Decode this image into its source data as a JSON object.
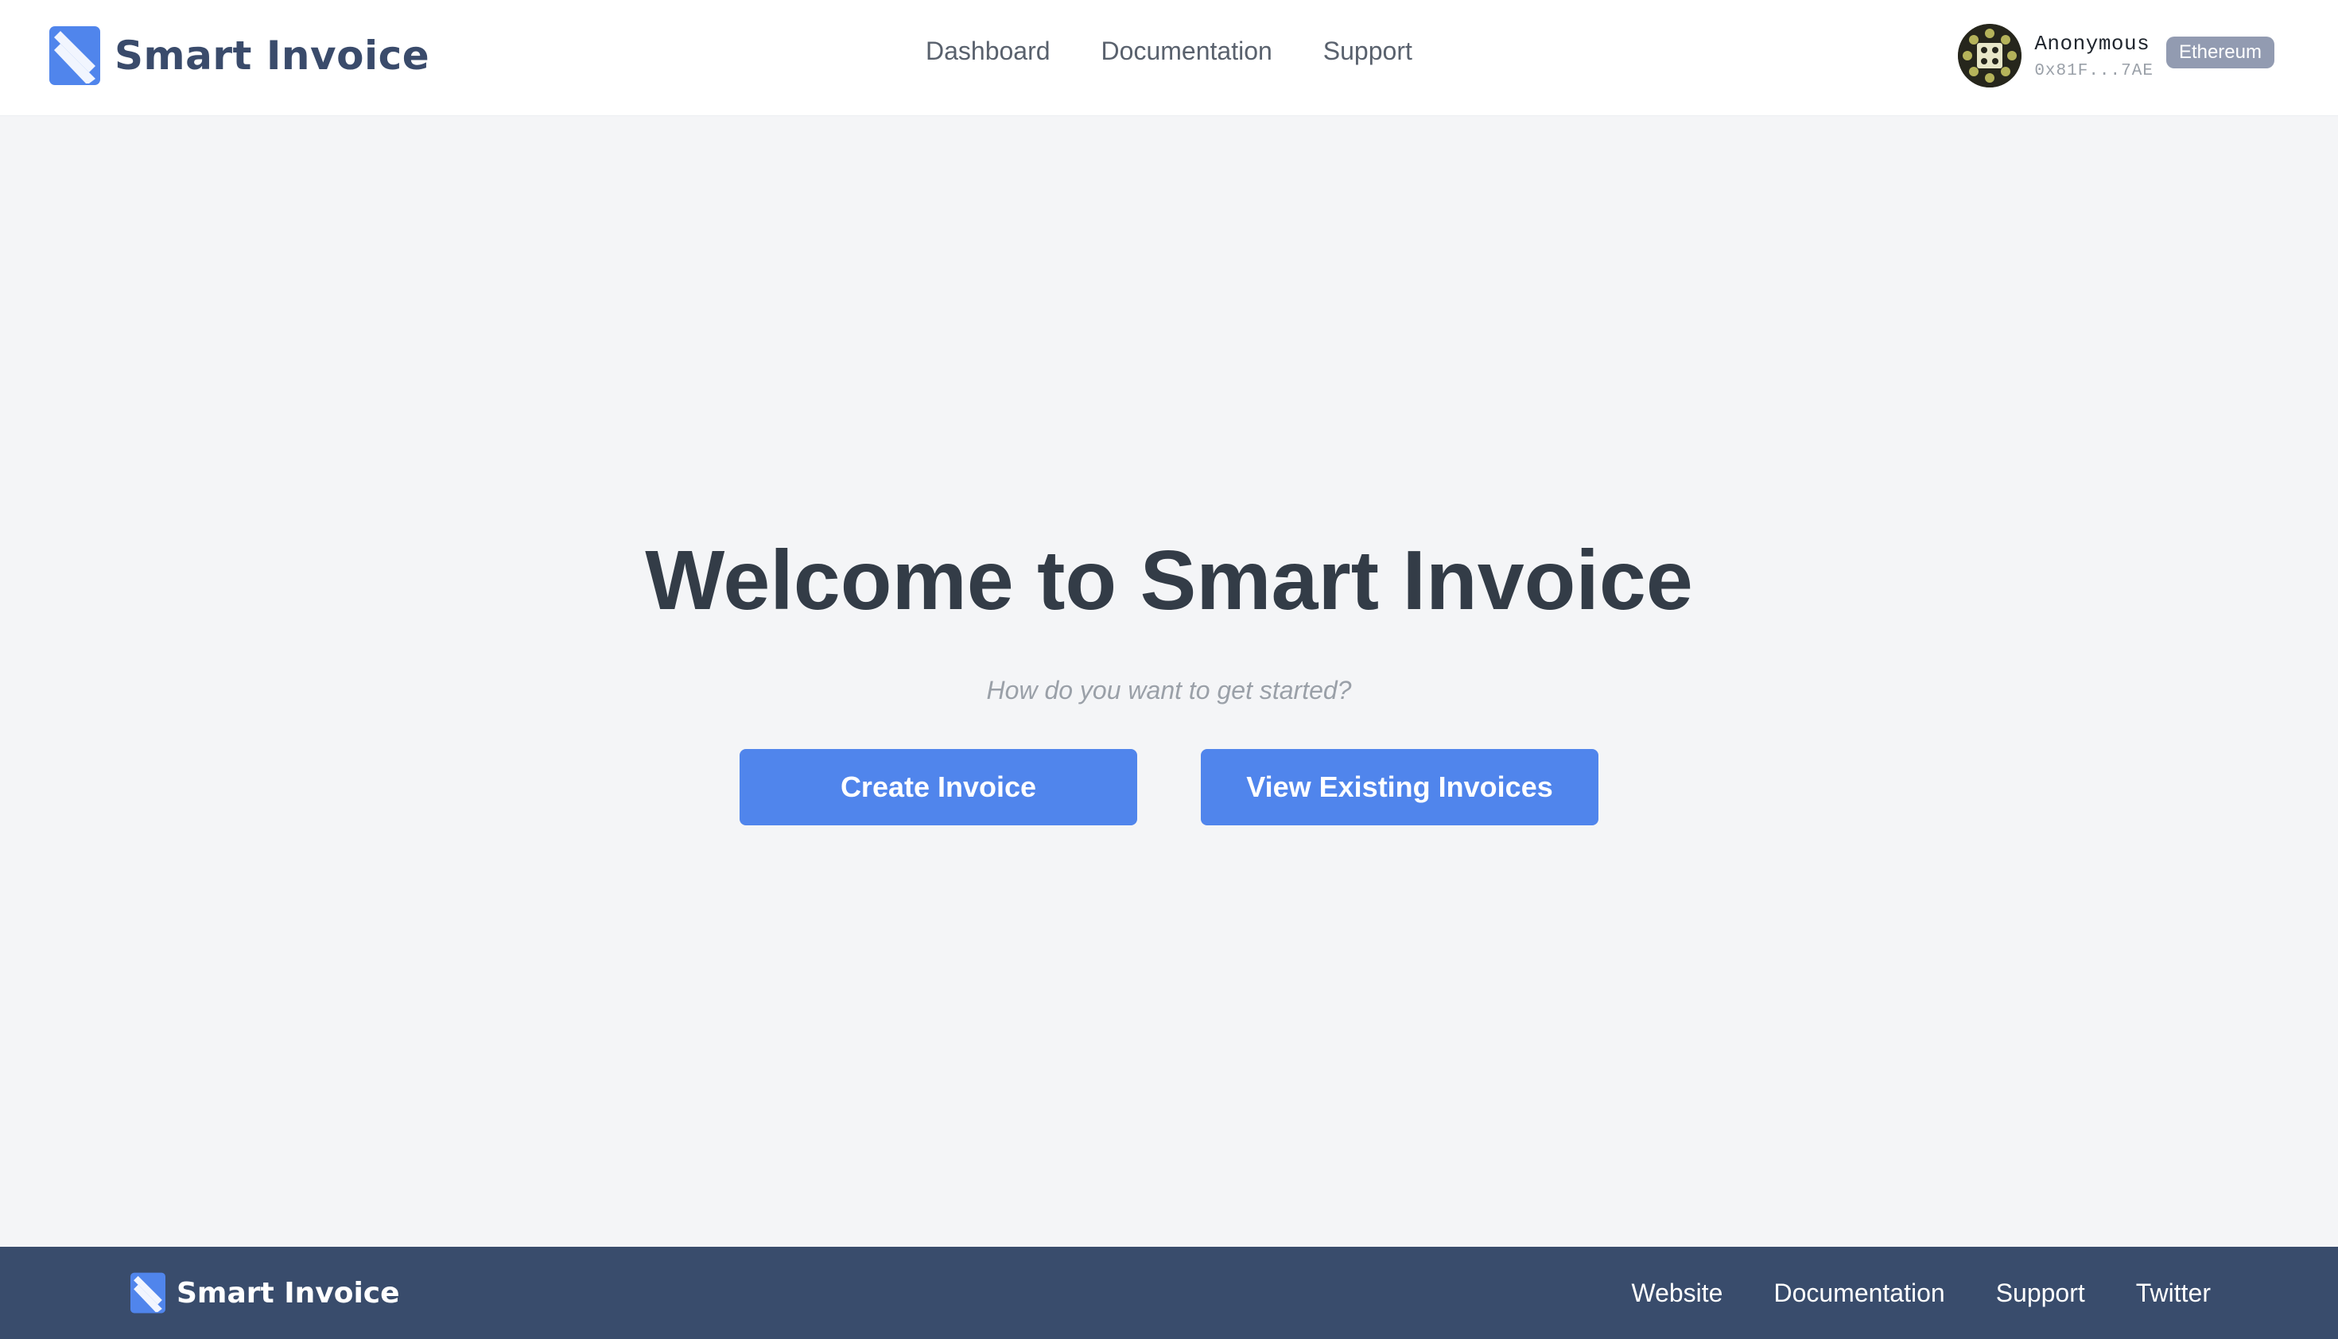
{
  "header": {
    "brand_name": "Smart Invoice",
    "nav": [
      "Dashboard",
      "Documentation",
      "Support"
    ],
    "account": {
      "name": "Anonymous",
      "address": "0x81F...7AE",
      "network": "Ethereum"
    }
  },
  "main": {
    "title": "Welcome to Smart Invoice",
    "subtitle": "How do you want to get started?",
    "create_label": "Create Invoice",
    "view_label": "View Existing Invoices"
  },
  "footer": {
    "brand_name": "Smart Invoice",
    "links": [
      "Website",
      "Documentation",
      "Support",
      "Twitter"
    ]
  },
  "colors": {
    "accent": "#5085ec",
    "brand_text": "#3a4b6b",
    "footer_bg": "#394c6c",
    "page_bg": "#f4f5f7",
    "network_badge": "#929bb1"
  },
  "icons": {
    "logo": "smart-invoice-logo-icon",
    "avatar": "identicon-avatar"
  }
}
